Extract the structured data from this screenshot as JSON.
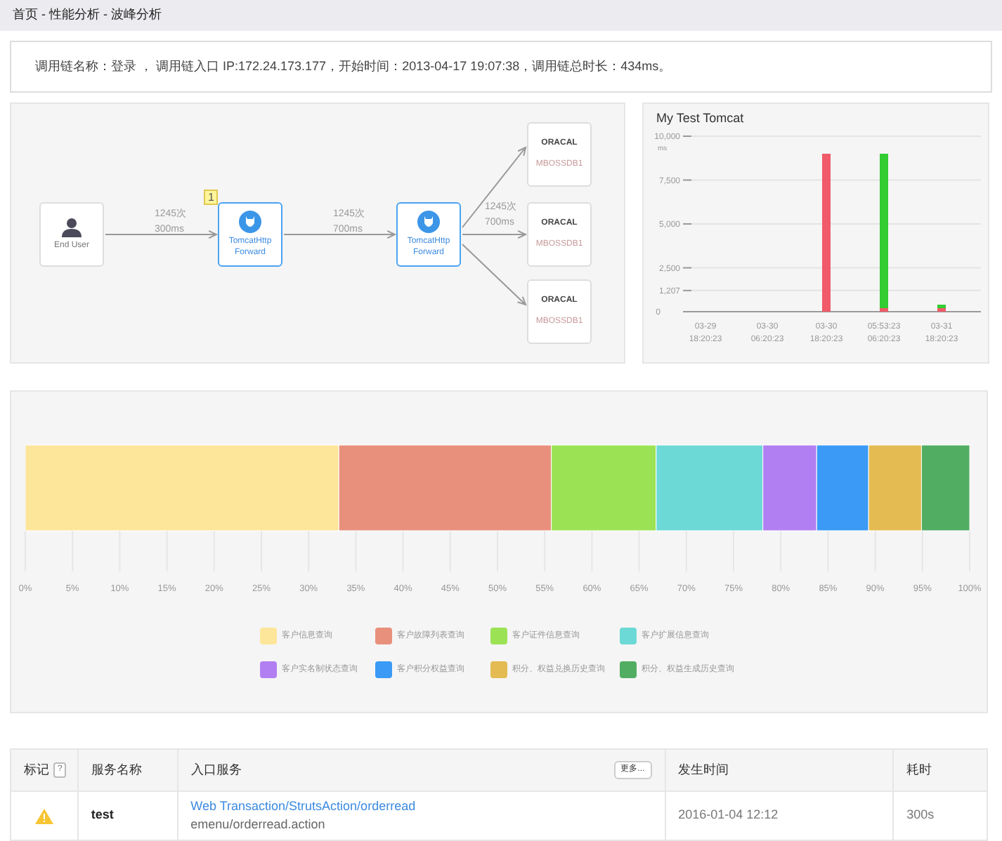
{
  "breadcrumb": "首页 - 性能分析 - 波峰分析",
  "summary": "调用链名称：登录 ， 调用链入口 IP:172.24.173.177，开始时间：2013-04-17 19:07:38，调用链总时长：434ms。",
  "topology": {
    "flow": [
      {
        "kind": "user",
        "label": "End User"
      },
      {
        "kind": "service",
        "label": "TomcatHttp Forward",
        "badge": "1",
        "in_edge": {
          "count": "1245次",
          "time": "300ms"
        }
      },
      {
        "kind": "service",
        "label": "TomcatHttp Forward",
        "in_edge": {
          "count": "1245次",
          "time": "700ms"
        }
      }
    ],
    "targets": [
      {
        "label": "ORACAL",
        "sublabel": "MBOSSDB1"
      },
      {
        "label": "ORACAL",
        "sublabel": "MBOSSDB1",
        "in_edge": {
          "count": "1245次",
          "time": "700ms"
        }
      },
      {
        "label": "ORACAL",
        "sublabel": "MBOSSDB1"
      }
    ]
  },
  "tomcat": {
    "title": "My Test Tomcat",
    "unit": "ms",
    "chart_data": {
      "type": "bar",
      "stacked": true,
      "categories": [
        "03-29 18:20:23",
        "03-30 06:20:23",
        "03-30 18:20:23",
        "05:53:23 06:20:23",
        "03-31 18:20:23"
      ],
      "series": [
        {
          "color": "#f05a6a",
          "values": [
            0,
            0,
            9000,
            200,
            200
          ]
        },
        {
          "color": "#33cc33",
          "values": [
            0,
            0,
            0,
            8800,
            200
          ]
        }
      ],
      "grid": true,
      "ylim": [
        0,
        10000
      ],
      "yticks": [
        {
          "value": 0,
          "label": "0"
        },
        {
          "value": 1207,
          "label": "1,207"
        },
        {
          "value": 2500,
          "label": "2,500"
        },
        {
          "value": 5000,
          "label": "5,000"
        },
        {
          "value": 7500,
          "label": "7,500"
        },
        {
          "value": 10000,
          "label": "10,000"
        }
      ]
    }
  },
  "distribution": {
    "chart_data": {
      "type": "bar",
      "orientation": "horizontal",
      "stacked": true,
      "grid": true,
      "xlim": [
        0,
        100
      ],
      "xticks": [
        {
          "value": 0,
          "label": "0%"
        },
        {
          "value": 5,
          "label": "5%"
        },
        {
          "value": 10,
          "label": "10%"
        },
        {
          "value": 15,
          "label": "15%"
        },
        {
          "value": 20,
          "label": "20%"
        },
        {
          "value": 25,
          "label": "25%"
        },
        {
          "value": 30,
          "label": "30%"
        },
        {
          "value": 35,
          "label": "35%"
        },
        {
          "value": 40,
          "label": "40%"
        },
        {
          "value": 45,
          "label": "45%"
        },
        {
          "value": 50,
          "label": "50%"
        },
        {
          "value": 55,
          "label": "55%"
        },
        {
          "value": 60,
          "label": "60%"
        },
        {
          "value": 65,
          "label": "65%"
        },
        {
          "value": 70,
          "label": "70%"
        },
        {
          "value": 75,
          "label": "75%"
        },
        {
          "value": 80,
          "label": "80%"
        },
        {
          "value": 85,
          "label": "85%"
        },
        {
          "value": 90,
          "label": "90%"
        },
        {
          "value": 95,
          "label": "95%"
        },
        {
          "value": 100,
          "label": "100%"
        }
      ],
      "series": [
        {
          "name": "客户信息查询",
          "color": "#fde59a",
          "values": [
            33.2
          ]
        },
        {
          "name": "客户故障列表查询",
          "color": "#e8907c",
          "values": [
            22.5
          ]
        },
        {
          "name": "客户证件信息查询",
          "color": "#9be354",
          "values": [
            11.1
          ]
        },
        {
          "name": "客户扩展信息查询",
          "color": "#6dd9d6",
          "values": [
            11.3
          ]
        },
        {
          "name": "客户实名制状态查询",
          "color": "#b27ff2",
          "values": [
            5.7
          ]
        },
        {
          "name": "客户积分权益查询",
          "color": "#3a9af5",
          "values": [
            5.5
          ]
        },
        {
          "name": "积分、权益兑换历史查询",
          "color": "#e3bb52",
          "values": [
            5.6
          ]
        },
        {
          "name": "积分、权益生成历史查询",
          "color": "#51ad62",
          "values": [
            5.1
          ]
        }
      ]
    }
  },
  "table": {
    "columns": [
      {
        "label": "标记",
        "help": "?"
      },
      {
        "label": "服务名称"
      },
      {
        "label": "入口服务",
        "button": "更多..."
      },
      {
        "label": "发生时间"
      },
      {
        "label": "耗时"
      }
    ],
    "rows": [
      {
        "warning": true,
        "service": "test",
        "entry_link": "Web Transaction/StrutsAction/orderread",
        "entry_path": "emenu/orderread.action",
        "time": "2016-01-04 12:12",
        "duration": "300s"
      }
    ]
  }
}
